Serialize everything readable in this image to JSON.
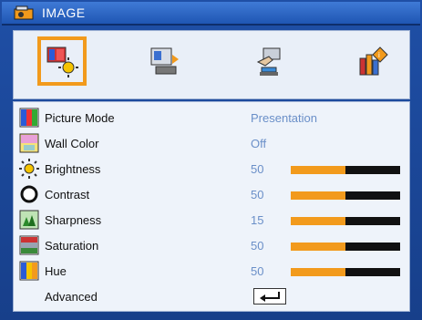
{
  "header": {
    "title": "IMAGE",
    "title_icon": "projector-icon"
  },
  "tabs": [
    {
      "name": "image-tab",
      "icon": "image-settings-icon",
      "active": true
    },
    {
      "name": "display-tab",
      "icon": "display-screen-icon",
      "active": false
    },
    {
      "name": "setup-tab",
      "icon": "setup-hand-icon",
      "active": false
    },
    {
      "name": "options-tab",
      "icon": "options-info-icon",
      "active": false
    }
  ],
  "menu": {
    "items": [
      {
        "label": "Picture Mode",
        "value": "Presentation",
        "icon": "picture-mode-icon"
      },
      {
        "label": "Wall Color",
        "value": "Off",
        "icon": "wall-color-icon"
      },
      {
        "label": "Brightness",
        "value": "50",
        "level": 0.5,
        "icon": "brightness-sun-icon"
      },
      {
        "label": "Contrast",
        "value": "50",
        "level": 0.5,
        "icon": "contrast-circle-icon"
      },
      {
        "label": "Sharpness",
        "value": "15",
        "level": 0.5,
        "icon": "sharpness-icon"
      },
      {
        "label": "Saturation",
        "value": "50",
        "level": 0.5,
        "icon": "saturation-icon"
      },
      {
        "label": "Hue",
        "value": "50",
        "level": 0.5,
        "icon": "hue-icon"
      },
      {
        "label": "Advanced",
        "icon": "enter-arrow-icon"
      }
    ]
  },
  "colors": {
    "frame": "#1f4fa6",
    "accent": "#f29a1c",
    "value_text": "#6a8fc8"
  }
}
